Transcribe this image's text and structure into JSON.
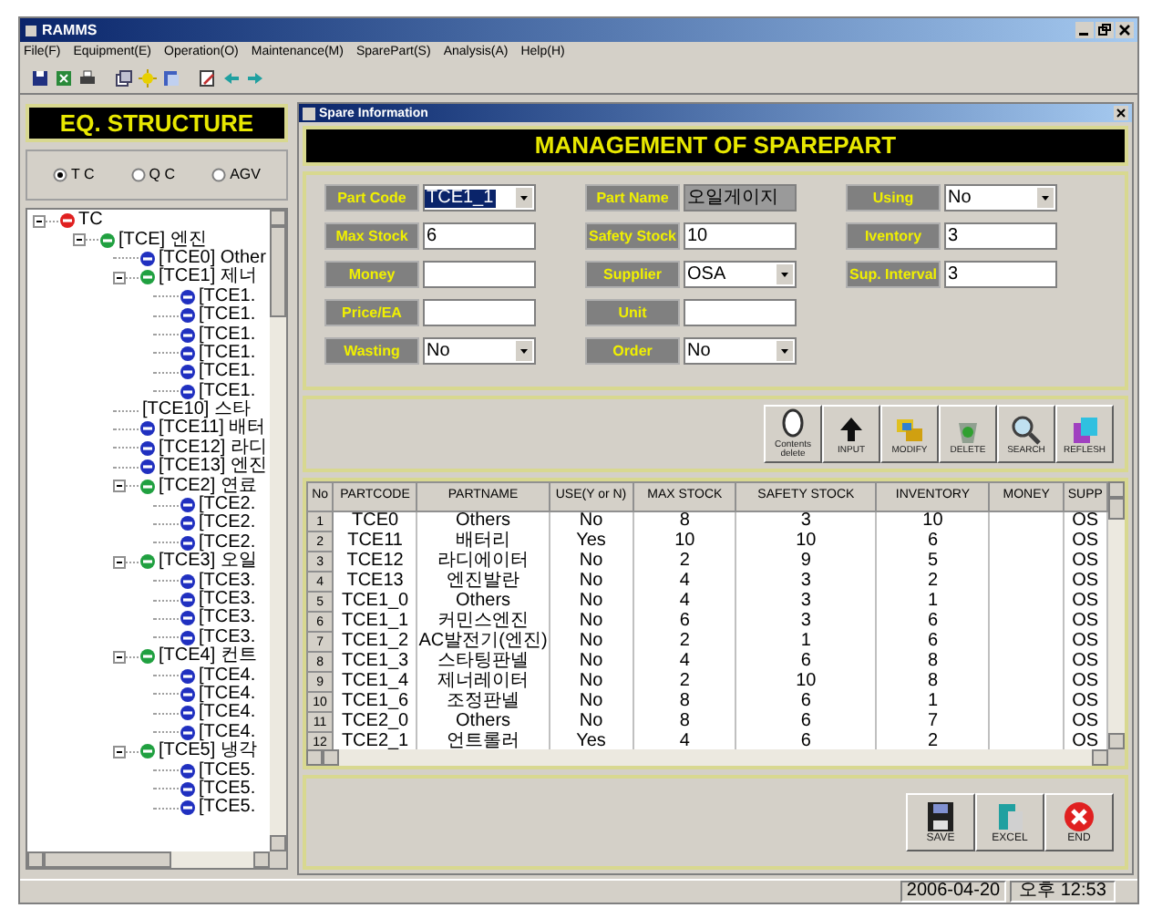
{
  "window": {
    "title": "RAMMS"
  },
  "menu": [
    "File(F)",
    "Equipment(E)",
    "Operation(O)",
    "Maintenance(M)",
    "SparePart(S)",
    "Analysis(A)",
    "Help(H)"
  ],
  "left_panel": {
    "title": "EQ. STRUCTURE",
    "radios": [
      {
        "label": "T C",
        "selected": true
      },
      {
        "label": "Q C",
        "selected": false
      },
      {
        "label": "AGV",
        "selected": false
      }
    ],
    "tree": [
      {
        "label": "TC",
        "kind": "root",
        "expanded": true,
        "children": [
          {
            "label": "[TCE] 엔진",
            "kind": "group",
            "expanded": true,
            "children": [
              {
                "label": "[TCE0] Other",
                "kind": "leaf"
              },
              {
                "label": "[TCE1] 제너",
                "kind": "group",
                "expanded": true,
                "children": [
                  {
                    "label": "[TCE1.",
                    "kind": "leaf"
                  },
                  {
                    "label": "[TCE1.",
                    "kind": "leaf"
                  },
                  {
                    "label": "[TCE1.",
                    "kind": "leaf"
                  },
                  {
                    "label": "[TCE1.",
                    "kind": "leaf"
                  },
                  {
                    "label": "[TCE1.",
                    "kind": "leaf"
                  },
                  {
                    "label": "[TCE1.",
                    "kind": "leaf"
                  }
                ]
              },
              {
                "label": "[TCE10] 스타",
                "kind": "plain"
              },
              {
                "label": "[TCE11] 배터",
                "kind": "leaf"
              },
              {
                "label": "[TCE12] 라디",
                "kind": "leaf"
              },
              {
                "label": "[TCE13] 엔진",
                "kind": "leaf"
              },
              {
                "label": "[TCE2] 연료",
                "kind": "group",
                "expanded": true,
                "children": [
                  {
                    "label": "[TCE2.",
                    "kind": "leaf"
                  },
                  {
                    "label": "[TCE2.",
                    "kind": "leaf"
                  },
                  {
                    "label": "[TCE2.",
                    "kind": "leaf"
                  }
                ]
              },
              {
                "label": "[TCE3] 오일",
                "kind": "group",
                "expanded": true,
                "children": [
                  {
                    "label": "[TCE3.",
                    "kind": "leaf"
                  },
                  {
                    "label": "[TCE3.",
                    "kind": "leaf"
                  },
                  {
                    "label": "[TCE3.",
                    "kind": "leaf"
                  },
                  {
                    "label": "[TCE3.",
                    "kind": "leaf"
                  }
                ]
              },
              {
                "label": "[TCE4] 컨트",
                "kind": "group",
                "expanded": true,
                "children": [
                  {
                    "label": "[TCE4.",
                    "kind": "leaf"
                  },
                  {
                    "label": "[TCE4.",
                    "kind": "leaf"
                  },
                  {
                    "label": "[TCE4.",
                    "kind": "leaf"
                  },
                  {
                    "label": "[TCE4.",
                    "kind": "leaf"
                  }
                ]
              },
              {
                "label": "[TCE5] 냉각",
                "kind": "group",
                "expanded": true,
                "children": [
                  {
                    "label": "[TCE5.",
                    "kind": "leaf"
                  },
                  {
                    "label": "[TCE5.",
                    "kind": "leaf"
                  },
                  {
                    "label": "[TCE5.",
                    "kind": "leaf"
                  }
                ]
              }
            ]
          }
        ]
      }
    ]
  },
  "child_window": {
    "title": "Spare Information",
    "header": "MANAGEMENT OF SPAREPART",
    "form_columns": [
      [
        {
          "label": "Part Code",
          "kind": "combo",
          "value": "TCE1_1",
          "highlighted": true
        },
        {
          "label": "Max Stock",
          "kind": "text",
          "value": "6"
        },
        {
          "label": "Money",
          "kind": "text"
        },
        {
          "label": "Price/EA",
          "kind": "text"
        },
        {
          "label": "Wasting",
          "kind": "combo",
          "value": "No"
        }
      ],
      [
        {
          "label": "Part Name",
          "kind": "readonly",
          "value": "오일게이지"
        },
        {
          "label": "Safety Stock",
          "kind": "text",
          "value": "10"
        },
        {
          "label": "Supplier",
          "kind": "combo",
          "value": "OSA"
        },
        {
          "label": "Unit",
          "kind": "text"
        },
        {
          "label": "Order",
          "kind": "combo",
          "value": "No"
        }
      ],
      [
        {
          "label": "Using",
          "kind": "combo",
          "value": "No"
        },
        {
          "label": "Iventory",
          "kind": "text",
          "value": "3"
        },
        {
          "label": "Sup. Interval",
          "kind": "text",
          "value": "3"
        }
      ]
    ],
    "actions": [
      "Contents delete",
      "INPUT",
      "MODIFY",
      "DELETE",
      "SEARCH",
      "REFLESH"
    ],
    "table": {
      "columns": [
        "No",
        "PARTCODE",
        "PARTNAME",
        "USE(Y or N)",
        "MAX STOCK",
        "SAFETY STOCK",
        "INVENTORY",
        "MONEY",
        "SUPP"
      ],
      "rows": [
        [
          "1",
          "TCE0",
          "Others",
          "No",
          "8",
          "3",
          "10",
          "",
          "OS"
        ],
        [
          "2",
          "TCE11",
          "배터리",
          "Yes",
          "10",
          "10",
          "6",
          "",
          "OS"
        ],
        [
          "3",
          "TCE12",
          "라디에이터",
          "No",
          "2",
          "9",
          "5",
          "",
          "OS"
        ],
        [
          "4",
          "TCE13",
          "엔진발란",
          "No",
          "4",
          "3",
          "2",
          "",
          "OS"
        ],
        [
          "5",
          "TCE1_0",
          "Others",
          "No",
          "4",
          "3",
          "1",
          "",
          "OS"
        ],
        [
          "6",
          "TCE1_1",
          "커민스엔진",
          "No",
          "6",
          "3",
          "6",
          "",
          "OS"
        ],
        [
          "7",
          "TCE1_2",
          "AC발전기(엔진)",
          "No",
          "2",
          "1",
          "6",
          "",
          "OS"
        ],
        [
          "8",
          "TCE1_3",
          "스타팅판넬",
          "No",
          "4",
          "6",
          "8",
          "",
          "OS"
        ],
        [
          "9",
          "TCE1_4",
          "제너레이터",
          "No",
          "2",
          "10",
          "8",
          "",
          "OS"
        ],
        [
          "10",
          "TCE1_6",
          "조정판넬",
          "No",
          "8",
          "6",
          "1",
          "",
          "OS"
        ],
        [
          "11",
          "TCE2_0",
          "Others",
          "No",
          "8",
          "6",
          "7",
          "",
          "OS"
        ],
        [
          "12",
          "TCE2_1",
          "언트롤러",
          "Yes",
          "4",
          "6",
          "2",
          "",
          "OS"
        ]
      ]
    },
    "bottom_buttons": [
      "SAVE",
      "EXCEL",
      "END"
    ]
  },
  "status_bar": [
    "2006-04-20",
    "오후 12:53"
  ]
}
